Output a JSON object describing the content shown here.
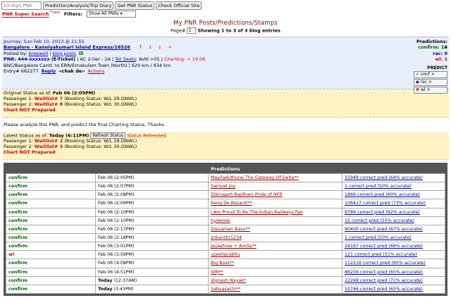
{
  "topbar": {
    "pnr_placeholder": "10-digit PNR",
    "btn_prediction": "Prediction/Analysis/Trip Diary",
    "btn_get_status": "Get PNR Status",
    "btn_official": "Check Official Site"
  },
  "row2": {
    "super_search": "PNR Super Search",
    "new_tag": "**new",
    "filters_label": "Filters:",
    "filter_value": "Show All PNRs"
  },
  "heading": "My PNR Posts/Predictions/Stamps",
  "pager": {
    "page_label": "Page#",
    "page_value": "1",
    "showing": "Showing 1 to 3 of 3 blog entries"
  },
  "entry": {
    "journey": "Journey: Sun Feb 10, 2013 @ 21:55",
    "train": "Bangalore - Kanniyakumari Island Express/16526",
    "arrow_up": "↑",
    "arrow_up2": "↓",
    "arrow_down": "↓",
    "arrow_down2": "→",
    "posted_by_label": "Posted by:",
    "posted_by_user": "breewell",
    "blog_posts": "blog posts",
    "pnr": "PNR: 444-xxxxxxx",
    "eticket": "(E-Ticket)",
    "class_info": "| AC 2-tier - 2A |",
    "tot_seats": "Tot Seats",
    "avbl": ": Avbl >55 |",
    "charting": "Charting: < 19:06",
    "route": "BNC/Bangalore Cantt.  to  ERN/Ernakulam Town (North)  |  620 km / 934 km",
    "entry_no": "Entry# 662277",
    "reply": "Reply",
    "chakde": "«chak de»",
    "actions": "Actions",
    "predictions_label": "Predictions: 14",
    "confirm_label": "confirm: 13",
    "rac_label": "rac: 0",
    "wl_label": "wl: 1",
    "predict_title": "PREDICT",
    "pbtn_conf": "conf",
    "pbtn_rac": "rac",
    "pbtn_wl": "wl",
    "x_mark": "×",
    "check_mark": "✔",
    "arrows_mark": "◆",
    "cross_mark": "✖"
  },
  "orig": {
    "title": "Original Status as of:",
    "date": "Feb 06 (2:05PM)",
    "p1_label": "Passenger 1:",
    "p1_wl": "Waitlist# 7",
    "p1_booking": "(Booking Status: W/L 29,GNWL)",
    "p2_label": "Passenger 2:",
    "p2_wl": "Waitlist# 8",
    "p2_booking": "(Booking Status: W/L 30,GNWL)",
    "chart": "Chart NOT Prepared"
  },
  "analyze_text": "Please analyze this PNR, and predict the final Charting Status. Thanks.",
  "latest": {
    "title": "Latest Status as of:",
    "date": "Today (6:11PM)",
    "refresh": "Refresh Status",
    "refreshed": "Status Refreshed.",
    "p1_label": "Passenger 1:",
    "p1_wl": "Waitlist# 2",
    "p1_booking": "(Booking Status: W/L 29,GNWL)",
    "p2_label": "Passenger 2:",
    "p2_wl": "Waitlist# 3",
    "p2_booking": "(Booking Status: W/L 30,GNWL)",
    "chart": "Chart NOT Prepared"
  },
  "predictions": {
    "header": "Predictions",
    "rows": [
      {
        "status": "confirm",
        "date": "Feb 06 (2:05PM)",
        "user": "Mayiladuthurai The Gateway Of Delta**",
        "acc": "15949 correct pred (64% accurate)"
      },
      {
        "status": "confirm",
        "date": "Feb 06 (2:07PM)",
        "user": "Samuel Joy",
        "acc": "1 correct pred (50% accurate)"
      },
      {
        "status": "confirm",
        "date": "Feb 06 (2:08PM)",
        "user": "Dibrugarh Rajdhani Pride of NFR",
        "acc": "1846 correct pred (60% accurate)"
      },
      {
        "status": "confirm",
        "date": "Feb 06 (2:09PM)",
        "user": "Rang De Basanti**",
        "acc": "106417 correct pred (73% accurate)"
      },
      {
        "status": "confirm",
        "date": "Feb 06 (2:10PM)",
        "user": "I Am Proud To Be The Indian Railways Fan",
        "acc": "9789 correct pred (62% accurate)"
      },
      {
        "status": "confirm",
        "date": "Feb 06 (2:10PM)",
        "user": "hyderoei",
        "acc": "15 correct pred (55% accurate)"
      },
      {
        "status": "confirm",
        "date": "Feb 06 (2:17PM)",
        "user": "Dipyamen Basu**",
        "acc": "90400 correct pred (67% accurate)"
      },
      {
        "status": "confirm",
        "date": "Feb 06 (2:18PM)",
        "user": "srikanthr1234",
        "acc": "1 correct pred (50% accurate)"
      },
      {
        "status": "confirm",
        "date": "Feb 06 (3:01PM)",
        "user": "Jayashree + Amita**",
        "acc": "24167 correct pred (66% accurate)"
      },
      {
        "status": "wl",
        "date": "Feb 06 (3:09PM)",
        "user": "upeshprabhu",
        "acc": "121 correct pred (51% accurate)"
      },
      {
        "status": "confirm",
        "date": "Feb 06 (4:08PM)",
        "user": "Big Boss**",
        "acc": "112216 correct pred (65% accurate)"
      },
      {
        "status": "confirm",
        "date": "Feb 06 (4:51PM)",
        "user": "SMJ**",
        "acc": "86256 correct pred (65% accurate)"
      },
      {
        "status": "confirm",
        "date_bold": "Today",
        "date": "(12:37AM)",
        "user": "Vignesh Nayak*",
        "acc": "22268 correct pred (71% accurate)"
      },
      {
        "status": "confirm",
        "date_bold": "Today",
        "date": "(3:43PM)",
        "user": "Sabyasachi**",
        "acc": "55746 correct pred (65% accurate)"
      }
    ]
  }
}
